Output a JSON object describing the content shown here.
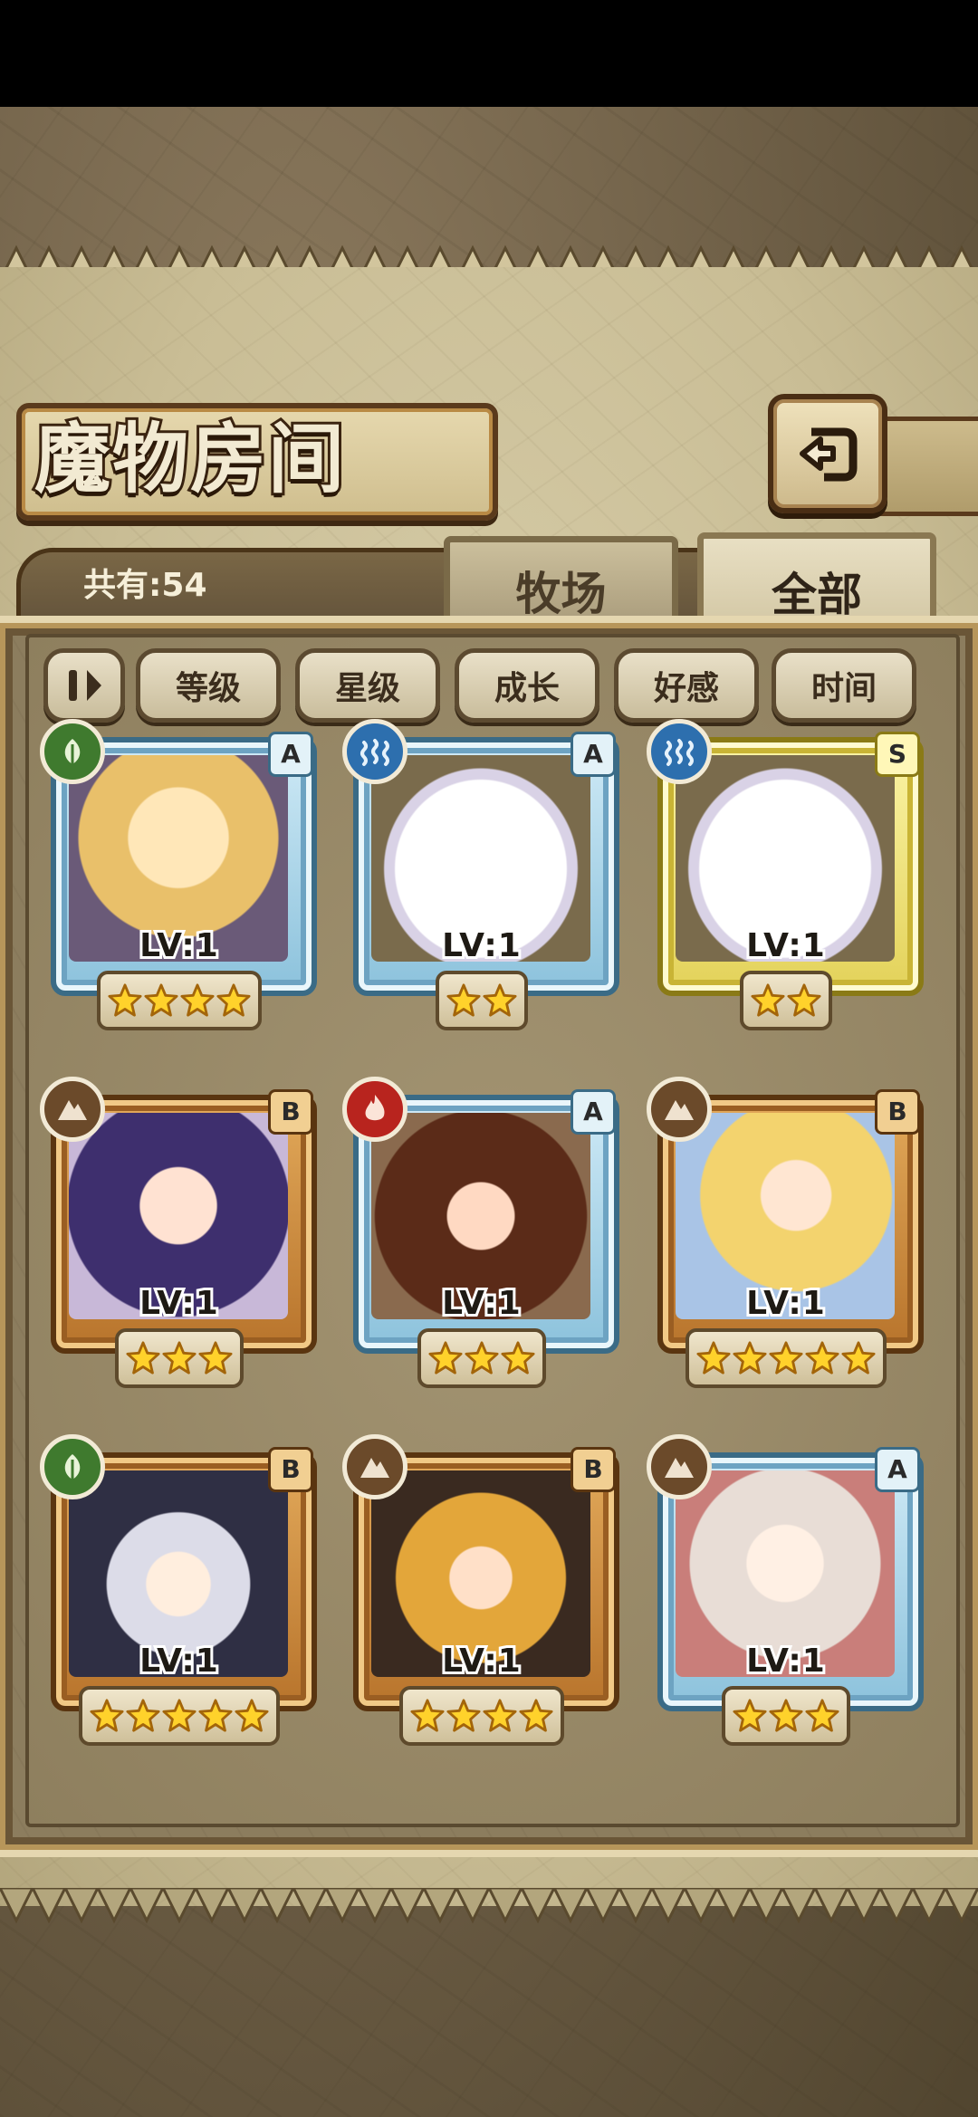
{
  "header": {
    "title": "魔物房间",
    "back_icon": "back-arrow-icon"
  },
  "summary": {
    "count_label": "共有:54"
  },
  "tabs": [
    {
      "label": "牧场",
      "selected": false
    },
    {
      "label": "全部",
      "selected": true
    }
  ],
  "sort": {
    "order_icon": "sort-order-icon",
    "options": [
      "等级",
      "星级",
      "成长",
      "好感",
      "时间"
    ]
  },
  "monsters": [
    {
      "level": "LV:1",
      "rank": "A",
      "element": "wood",
      "stars": 4,
      "frame_color": "#8cc2dc",
      "portrait": "blonde-horned-girl"
    },
    {
      "level": "LV:1",
      "rank": "A",
      "element": "water",
      "stars": 2,
      "frame_color": "#8cc2dc",
      "portrait": "white-slime-ghost"
    },
    {
      "level": "LV:1",
      "rank": "S",
      "element": "water",
      "stars": 2,
      "frame_color": "#e3d25a",
      "portrait": "white-slime-ghost"
    },
    {
      "level": "LV:1",
      "rank": "B",
      "element": "earth",
      "stars": 3,
      "frame_color": "#b8742c",
      "portrait": "purple-hair-girl"
    },
    {
      "level": "LV:1",
      "rank": "A",
      "element": "fire",
      "stars": 3,
      "frame_color": "#8cc2dc",
      "portrait": "brown-hair-goggles-girl"
    },
    {
      "level": "LV:1",
      "rank": "B",
      "element": "earth",
      "stars": 5,
      "frame_color": "#b8742c",
      "portrait": "blonde-doll-girl"
    },
    {
      "level": "LV:1",
      "rank": "B",
      "element": "wood",
      "stars": 5,
      "frame_color": "#b8742c",
      "portrait": "witch-hat-girl"
    },
    {
      "level": "LV:1",
      "rank": "B",
      "element": "earth",
      "stars": 4,
      "frame_color": "#b8742c",
      "portrait": "helmet-cat-girl"
    },
    {
      "level": "LV:1",
      "rank": "A",
      "element": "earth",
      "stars": 3,
      "frame_color": "#8cc2dc",
      "portrait": "bunny-ear-girl"
    }
  ]
}
